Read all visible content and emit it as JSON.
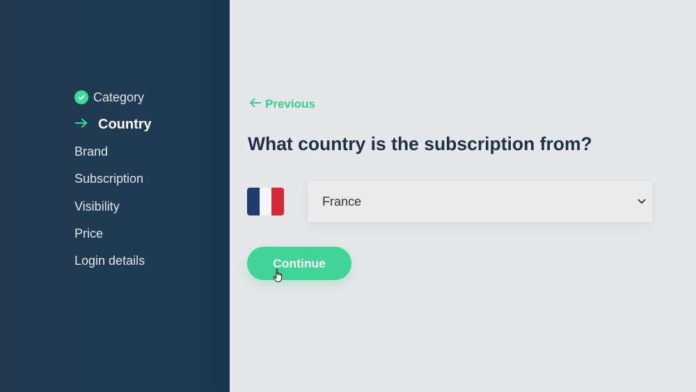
{
  "sidebar": {
    "steps": [
      {
        "label": "Category",
        "state": "done",
        "icon": "check-circle-icon"
      },
      {
        "label": "Country",
        "state": "current",
        "icon": "arrow-right-icon"
      },
      {
        "label": "Brand",
        "state": "pending"
      },
      {
        "label": "Subscription",
        "state": "pending"
      },
      {
        "label": "Visibility",
        "state": "pending"
      },
      {
        "label": "Price",
        "state": "pending"
      },
      {
        "label": "Login details",
        "state": "pending"
      }
    ]
  },
  "main": {
    "previous_label": "Previous",
    "question": "What country is the subscription from?",
    "country_select": {
      "selected": "France",
      "flag_icon": "france-flag-icon"
    },
    "continue_label": "Continue"
  },
  "colors": {
    "accent": "#3ddc97",
    "sidebar_bg": "#223a50",
    "heading": "#1e3148",
    "page_bg": "#e6e7e9"
  }
}
